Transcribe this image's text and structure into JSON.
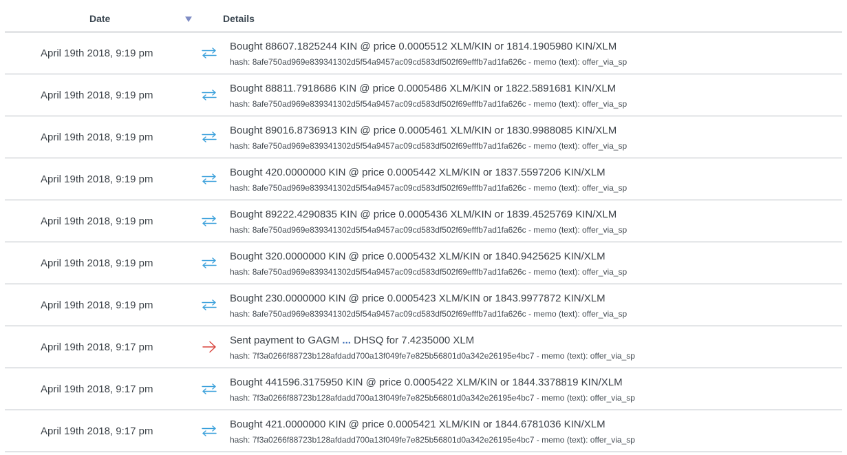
{
  "header": {
    "date_label": "Date",
    "details_label": "Details"
  },
  "colors": {
    "trade_icon": "#3aa0db",
    "payment_icon": "#d9443c",
    "sort_arrow": "#7f8cc4",
    "account_dots": "#3f70b8"
  },
  "rows": [
    {
      "type": "trade",
      "icon": "swap-arrows-icon",
      "date": "April 19th 2018, 9:19 pm",
      "main": "Bought 88607.1825244 KIN @ price 0.0005512 XLM/KIN or 1814.1905980 KIN/XLM",
      "sub": "hash: 8afe750ad969e839341302d5f54a9457ac09cd583df502f69efffb7ad1fa626c - memo (text): offer_via_sp"
    },
    {
      "type": "trade",
      "icon": "swap-arrows-icon",
      "date": "April 19th 2018, 9:19 pm",
      "main": "Bought 88811.7918686 KIN @ price 0.0005486 XLM/KIN or 1822.5891681 KIN/XLM",
      "sub": "hash: 8afe750ad969e839341302d5f54a9457ac09cd583df502f69efffb7ad1fa626c - memo (text): offer_via_sp"
    },
    {
      "type": "trade",
      "icon": "swap-arrows-icon",
      "date": "April 19th 2018, 9:19 pm",
      "main": "Bought 89016.8736913 KIN @ price 0.0005461 XLM/KIN or 1830.9988085 KIN/XLM",
      "sub": "hash: 8afe750ad969e839341302d5f54a9457ac09cd583df502f69efffb7ad1fa626c - memo (text): offer_via_sp"
    },
    {
      "type": "trade",
      "icon": "swap-arrows-icon",
      "date": "April 19th 2018, 9:19 pm",
      "main": "Bought 420.0000000 KIN @ price 0.0005442 XLM/KIN or 1837.5597206 KIN/XLM",
      "sub": "hash: 8afe750ad969e839341302d5f54a9457ac09cd583df502f69efffb7ad1fa626c - memo (text): offer_via_sp"
    },
    {
      "type": "trade",
      "icon": "swap-arrows-icon",
      "date": "April 19th 2018, 9:19 pm",
      "main": "Bought 89222.4290835 KIN @ price 0.0005436 XLM/KIN or 1839.4525769 KIN/XLM",
      "sub": "hash: 8afe750ad969e839341302d5f54a9457ac09cd583df502f69efffb7ad1fa626c - memo (text): offer_via_sp"
    },
    {
      "type": "trade",
      "icon": "swap-arrows-icon",
      "date": "April 19th 2018, 9:19 pm",
      "main": "Bought 320.0000000 KIN @ price 0.0005432 XLM/KIN or 1840.9425625 KIN/XLM",
      "sub": "hash: 8afe750ad969e839341302d5f54a9457ac09cd583df502f69efffb7ad1fa626c - memo (text): offer_via_sp"
    },
    {
      "type": "trade",
      "icon": "swap-arrows-icon",
      "date": "April 19th 2018, 9:19 pm",
      "main": "Bought 230.0000000 KIN @ price 0.0005423 XLM/KIN or 1843.9977872 KIN/XLM",
      "sub": "hash: 8afe750ad969e839341302d5f54a9457ac09cd583df502f69efffb7ad1fa626c - memo (text): offer_via_sp"
    },
    {
      "type": "payment",
      "icon": "sent-arrow-icon",
      "date": "April 19th 2018, 9:17 pm",
      "main_prefix": "Sent payment to ",
      "account_start": "GAGM",
      "account_dots": "...",
      "account_end": "DHSQ",
      "main_suffix": " for 7.4235000 XLM",
      "sub": "hash: 7f3a0266f88723b128afdadd700a13f049fe7e825b56801d0a342e26195e4bc7 - memo (text): offer_via_sp"
    },
    {
      "type": "trade",
      "icon": "swap-arrows-icon",
      "date": "April 19th 2018, 9:17 pm",
      "main": "Bought 441596.3175950 KIN @ price 0.0005422 XLM/KIN or 1844.3378819 KIN/XLM",
      "sub": "hash: 7f3a0266f88723b128afdadd700a13f049fe7e825b56801d0a342e26195e4bc7 - memo (text): offer_via_sp"
    },
    {
      "type": "trade",
      "icon": "swap-arrows-icon",
      "date": "April 19th 2018, 9:17 pm",
      "main": "Bought 421.0000000 KIN @ price 0.0005421 XLM/KIN or 1844.6781036 KIN/XLM",
      "sub": "hash: 7f3a0266f88723b128afdadd700a13f049fe7e825b56801d0a342e26195e4bc7 - memo (text): offer_via_sp"
    }
  ]
}
